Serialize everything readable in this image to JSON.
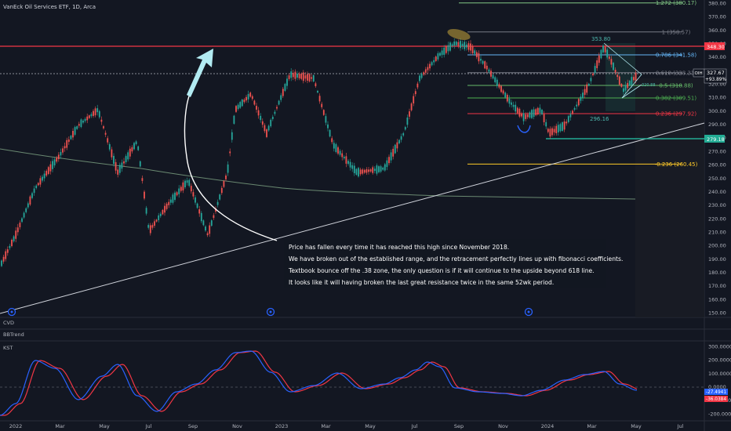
{
  "symbol": {
    "title": "VanEck Oil Services ETF, 1D, Arca"
  },
  "price_axis": {
    "ticks": [
      "380.00",
      "370.00",
      "360.00",
      "350.00",
      "340.00",
      "330.00",
      "320.00",
      "310.00",
      "300.00",
      "290.00",
      "280.00",
      "270.00",
      "260.00",
      "250.00",
      "240.00",
      "230.00",
      "220.00",
      "210.00",
      "200.00",
      "190.00",
      "180.00",
      "170.00",
      "160.00",
      "150.00"
    ],
    "current_price_tag": "327.67",
    "current_change_tag": "+93.89%",
    "symbol_tag": "OIH",
    "resistance_tag": "348.30",
    "support_tag": "279.18"
  },
  "time_axis": {
    "labels": [
      "2022",
      "Mar",
      "May",
      "Jul",
      "Sep",
      "Nov",
      "2023",
      "Mar",
      "May",
      "Jul",
      "Sep",
      "Nov",
      "2024",
      "Mar",
      "May",
      "Jul"
    ]
  },
  "fib_levels": [
    {
      "label": "1.272 (380.17)",
      "color": "#81c784"
    },
    {
      "label": "1 (358.57)",
      "color": "#787b86"
    },
    {
      "label": "0.786 (341.58)",
      "color": "#64b5f6"
    },
    {
      "label": "0.618 (328.31)",
      "color": "#787b86"
    },
    {
      "label": "0.5 (318.88)",
      "color": "#66bb6a"
    },
    {
      "label": "0.382 (309.51)",
      "color": "#4caf50"
    },
    {
      "label": "0.236 (297.92)",
      "color": "#f23645"
    },
    {
      "label": "-0.236 (260.45)",
      "color": "#ffca28"
    }
  ],
  "drawing_labels": {
    "swing_high": "353.80",
    "swing_low": "296.16",
    "small_price": "320.88"
  },
  "annotation": {
    "lines": [
      "Price has fallen every time it has reached this high since November 2018.",
      "We have broken out of the established range, and the retracement perfectly lines up with fibonacci coefficients.",
      "Textbook bounce off the .38 zone, the only question is if it will continue to the upside beyond 618 line.",
      "It looks like it will having broken the last great resistance twice in the same 52wk period."
    ]
  },
  "panes": {
    "cvd": {
      "label": "CVD"
    },
    "bbtrend": {
      "label": "BBTrend"
    },
    "kst": {
      "label": "KST",
      "ticks": [
        "300.0000",
        "200.0000",
        "100.0000",
        "0.0000",
        "-100.0000",
        "-200.0000"
      ],
      "tag_kst": "-27.4941",
      "tag_signal": "-36.0384",
      "kst_color": "#2962ff",
      "signal_color": "#f23645"
    }
  },
  "colors": {
    "background": "#131722",
    "up_candle": "#26a69a",
    "down_candle": "#ef5350",
    "resistance_line": "#f23645",
    "support_line": "#22ab94",
    "arrow": "#b2ebf2"
  }
}
